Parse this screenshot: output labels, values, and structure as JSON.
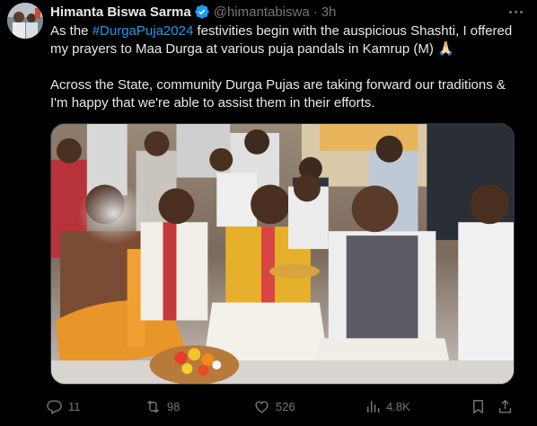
{
  "author": {
    "name": "Himanta Biswa Sarma",
    "handle": "@himantabiswa",
    "separator": "·",
    "time": "3h"
  },
  "tweet": {
    "line1_prefix": "As the ",
    "hashtag": "#DurgaPuja2024",
    "line1_suffix": " festivities begin with the auspicious Shashti, I offered my prayers to Maa Durga at various puja pandals in Kamrup (M) 🙏🏻",
    "paragraph2": "Across the State, community Durga Pujas are taking forward our traditions & I'm happy that we're able to assist them in their efforts."
  },
  "actions": {
    "replies": "11",
    "retweets": "98",
    "likes": "526",
    "views": "4.8K"
  },
  "colors": {
    "background": "#000000",
    "text": "#e7e9ea",
    "muted": "#71767b",
    "link": "#1d9bf0",
    "verified": "#1d9bf0"
  },
  "icons": [
    "verified-badge-icon",
    "more-icon",
    "reply-icon",
    "retweet-icon",
    "like-icon",
    "views-icon",
    "bookmark-icon",
    "share-icon"
  ]
}
